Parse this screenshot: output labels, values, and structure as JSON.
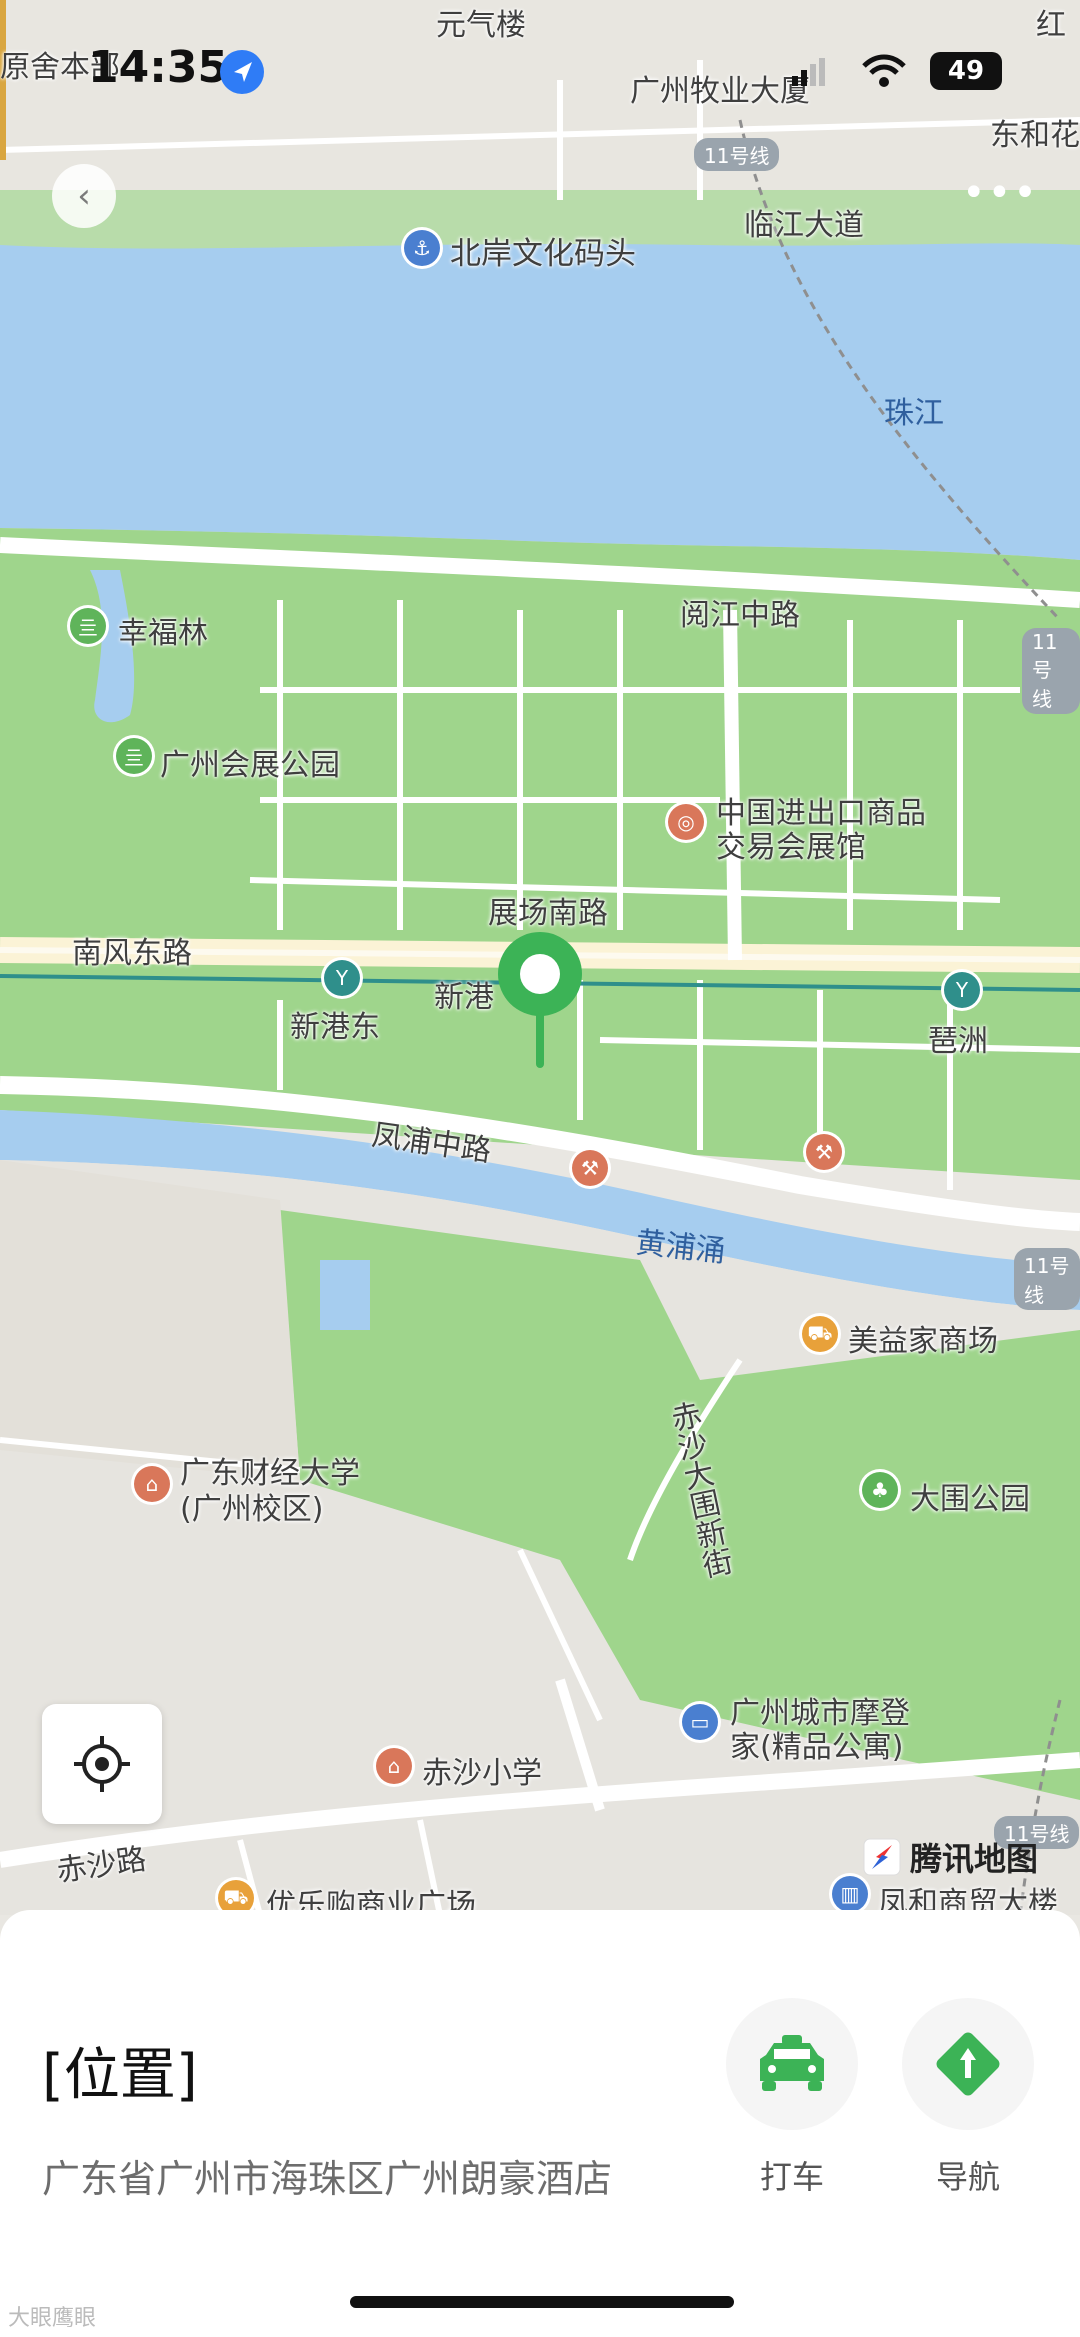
{
  "status_bar": {
    "time": "14:35",
    "battery": "49"
  },
  "map": {
    "brand": "腾讯地图",
    "water": {
      "river": "珠江",
      "canal": "黄浦涌"
    },
    "roads": [
      "临江大道",
      "阅江中路",
      "展场南路",
      "南风东路",
      "新港",
      "凤浦中路",
      "赤沙大围新街",
      "赤沙路"
    ],
    "metro_line": "11号线",
    "stations": [
      "新港东",
      "琶洲"
    ],
    "pois": {
      "top_left": "原舍本部",
      "qixianglou": "元气楼",
      "muye": "广州牧业大厦",
      "donghe": "东和花",
      "top_right": "红",
      "pier": "北岸文化码头",
      "xingfulin": "幸福林",
      "huizhan_park": "广州会展公园",
      "canton_fair_1": "中国进出口商品",
      "canton_fair_2": "交易会展馆",
      "meiyijia": "美益家商场",
      "gdufe_1": "广东财经大学",
      "gdufe_2": "(广州校区)",
      "dawei_park": "大围公园",
      "modeng_1": "广州城市摩登",
      "modeng_2": "家(精品公寓)",
      "chisha_school": "赤沙小学",
      "youlegou": "优乐购商业广场",
      "fenghe": "凤和商贸大楼"
    }
  },
  "panel": {
    "title": "[位置]",
    "address": "广东省广州市海珠区广州朗豪酒店",
    "actions": [
      {
        "label": "打车"
      },
      {
        "label": "导航"
      }
    ]
  },
  "watermark": "大眼鹰眼"
}
